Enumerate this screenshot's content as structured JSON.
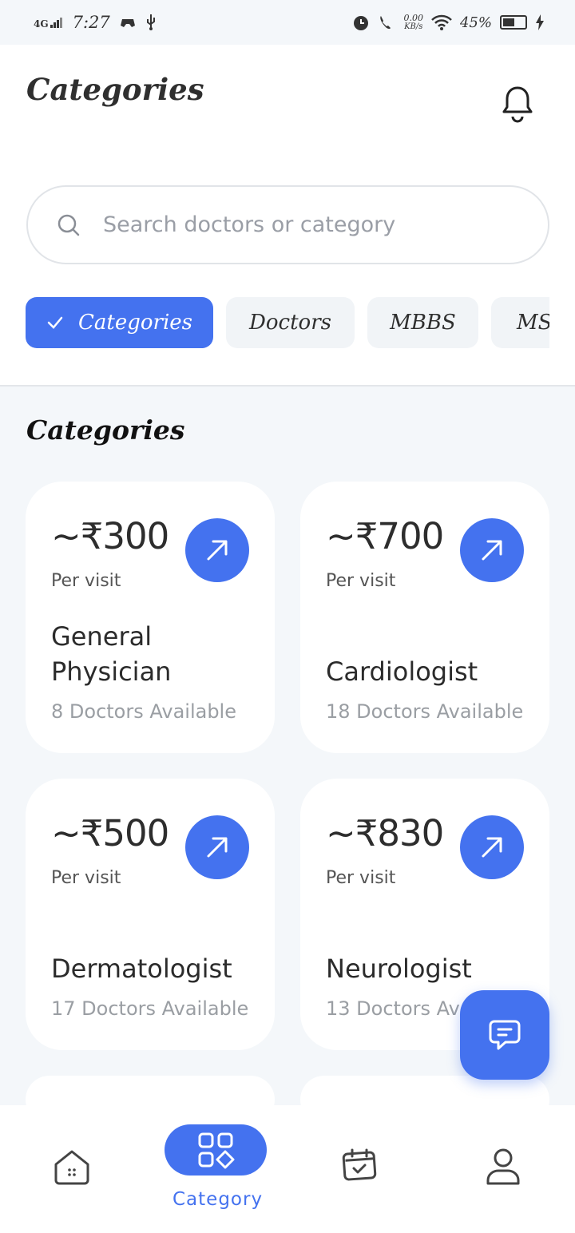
{
  "status_bar": {
    "network": "4G",
    "time": "7:27",
    "speed_value": "0.00",
    "speed_unit": "KB/s",
    "battery": "45%"
  },
  "header": {
    "title": "Categories",
    "search_placeholder": "Search doctors or category"
  },
  "chips": [
    {
      "label": "Categories",
      "active": true
    },
    {
      "label": "Doctors",
      "active": false
    },
    {
      "label": "MBBS",
      "active": false
    },
    {
      "label": "MS",
      "active": false
    }
  ],
  "section_title": "Categories",
  "cards": [
    {
      "price": "~₹300",
      "per": "Per visit",
      "name": "General Physician",
      "available": "8 Doctors Available"
    },
    {
      "price": "~₹700",
      "per": "Per visit",
      "name": "Cardiologist",
      "available": "18 Doctors Available"
    },
    {
      "price": "~₹500",
      "per": "Per visit",
      "name": "Dermatologist",
      "available": "17 Doctors Available"
    },
    {
      "price": "~₹830",
      "per": "Per visit",
      "name": "Neurologist",
      "available": "13 Doctors Available"
    }
  ],
  "bottom_nav": {
    "active_label": "Category",
    "items": [
      "home-icon",
      "category-icon",
      "calendar-icon",
      "profile-icon"
    ]
  },
  "colors": {
    "accent": "#4472ef",
    "background": "#f4f7fa"
  }
}
